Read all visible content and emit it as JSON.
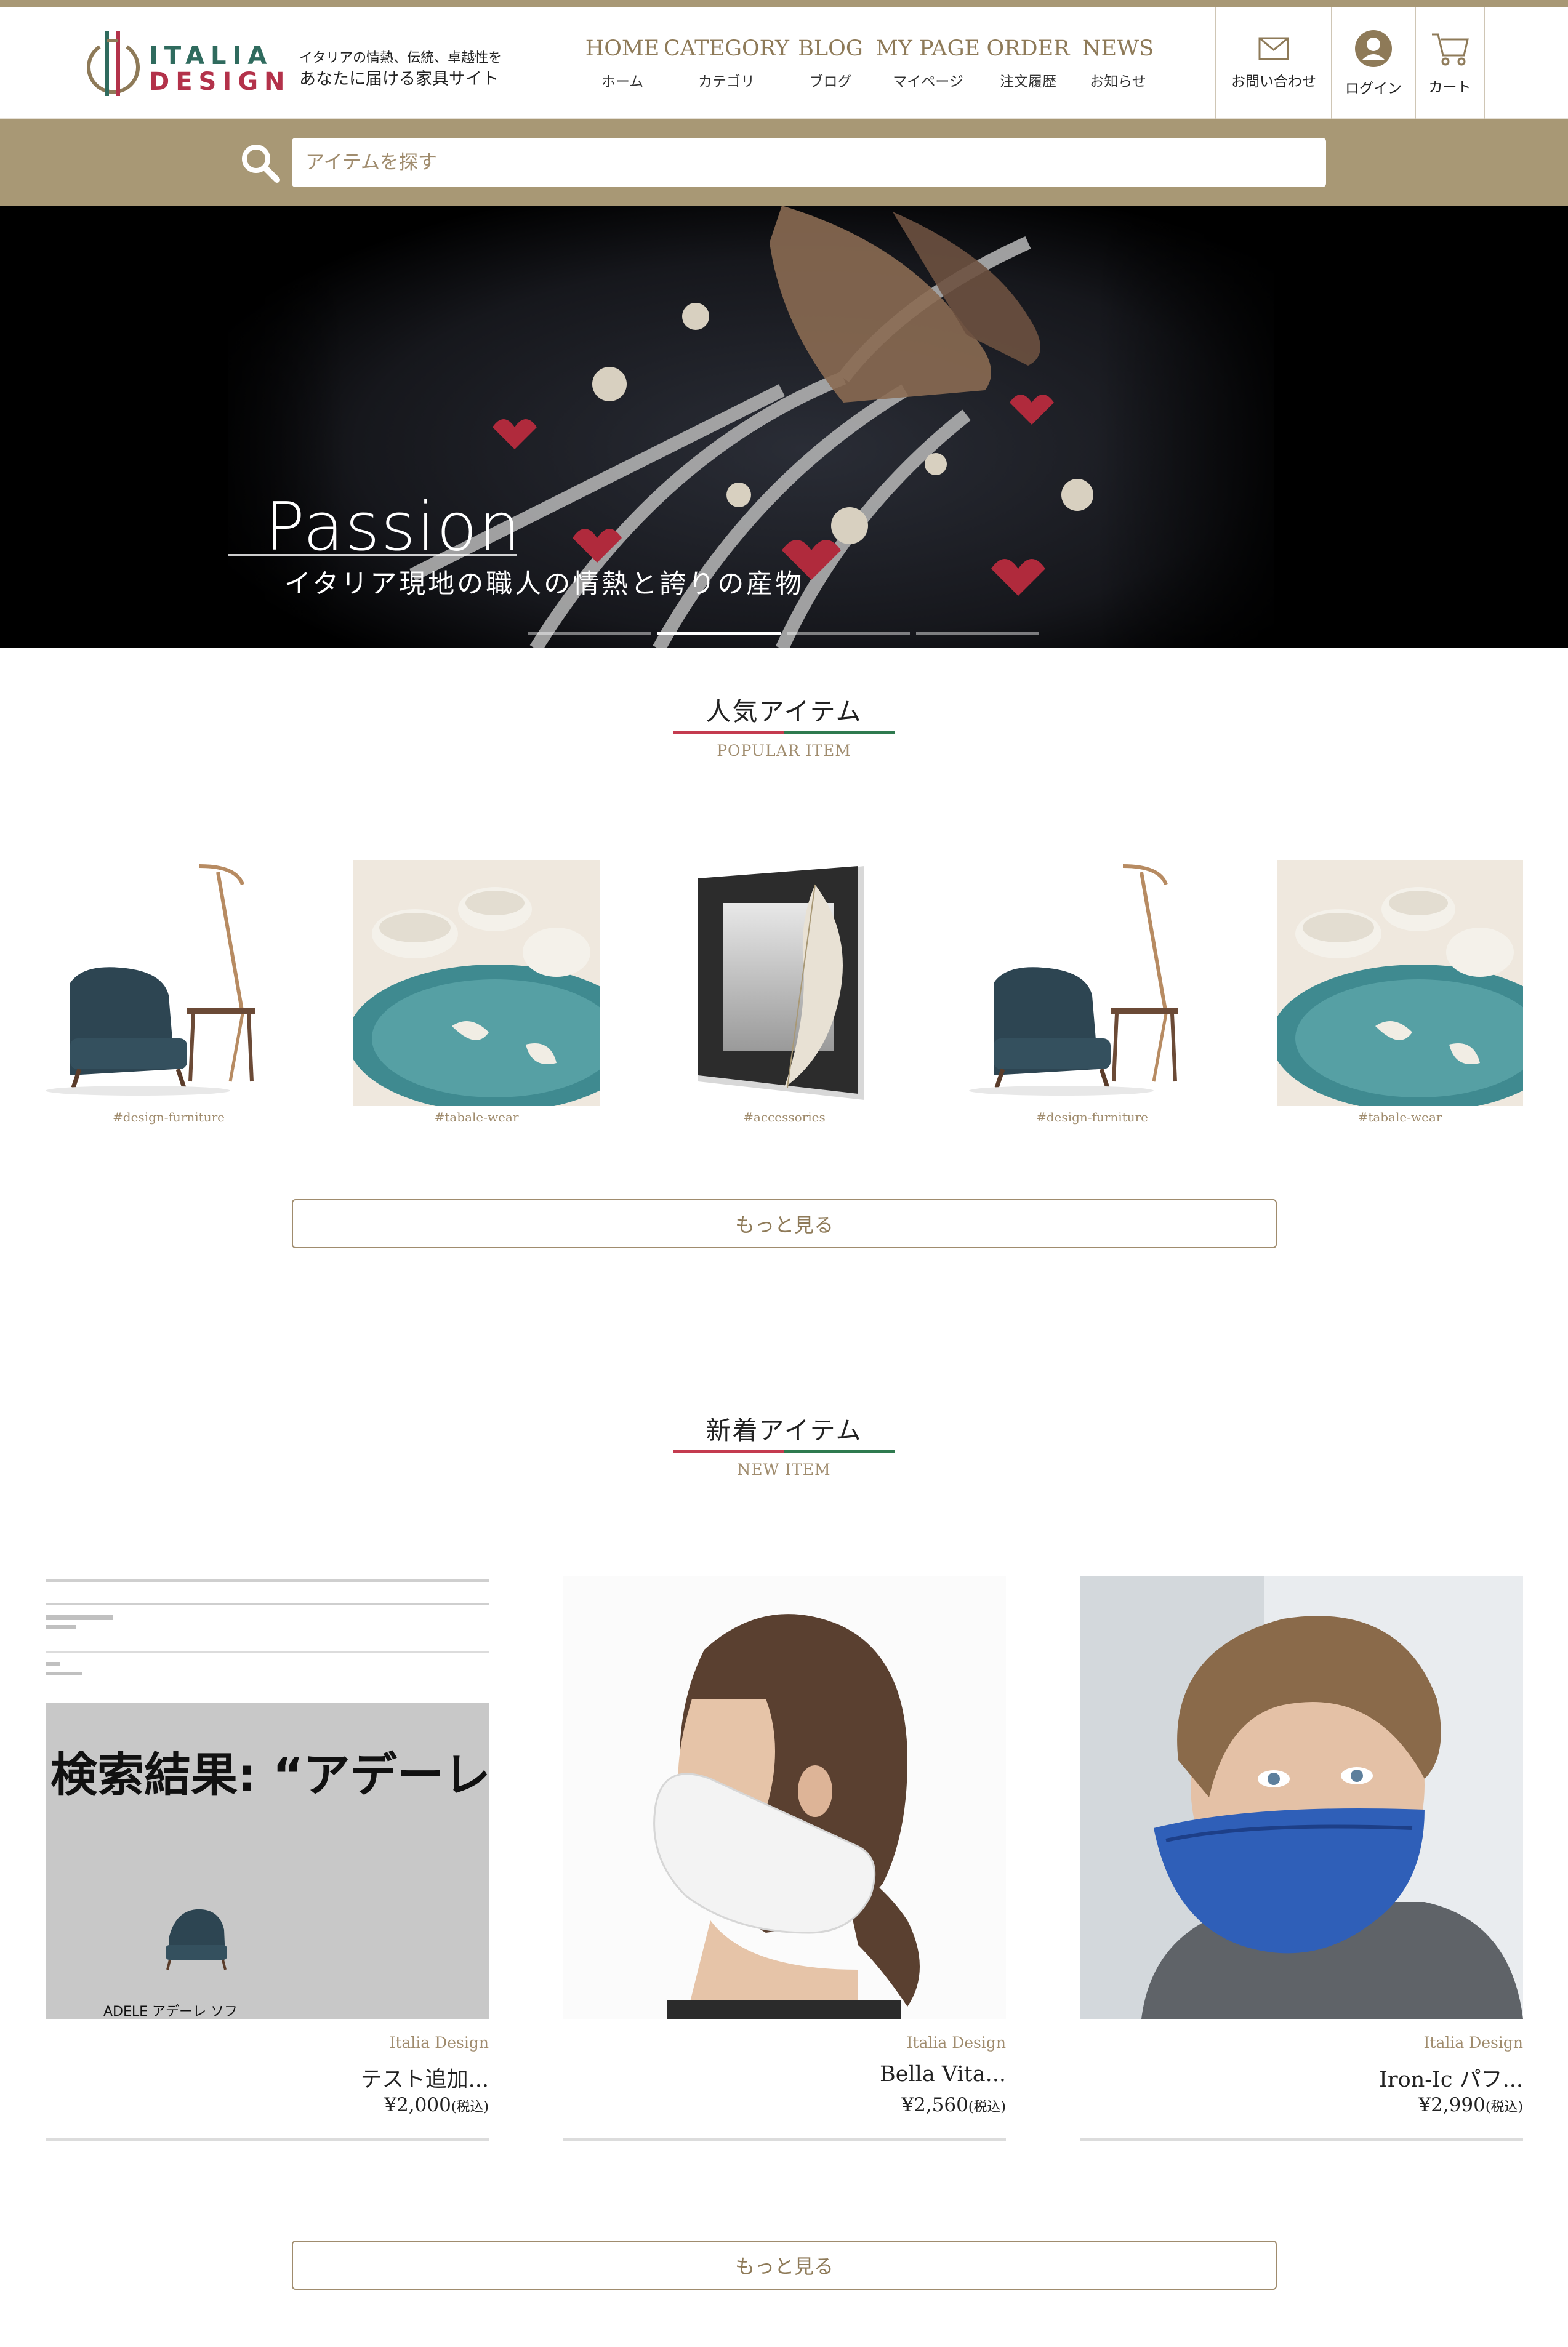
{
  "header": {
    "logo_line1": "ITALIA",
    "logo_line2": "DESIGN",
    "tagline_1": "イタリアの情熱、伝統、卓越性を",
    "tagline_2": "あなたに届ける家具サイト",
    "nav": [
      {
        "en": "HOME",
        "jp": "ホーム"
      },
      {
        "en": "CATEGORY",
        "jp": "カテゴリ"
      },
      {
        "en": "BLOG",
        "jp": "ブログ"
      },
      {
        "en": "MY PAGE",
        "jp": "マイページ"
      },
      {
        "en": "ORDER",
        "jp": "注文履歴"
      },
      {
        "en": "NEWS",
        "jp": "お知らせ"
      }
    ],
    "contact_label": "お問い合わせ",
    "login_label": "ログイン",
    "cart_label": "カート"
  },
  "search": {
    "placeholder": "アイテムを探す"
  },
  "hero": {
    "title": "Passion",
    "subtitle": "イタリア現地の職人の情熱と誇りの産物",
    "slide_count": 4,
    "active_slide": 2
  },
  "popular": {
    "title": "人気アイテム",
    "subtitle": "POPULAR ITEM",
    "items": [
      {
        "tag": "#design-furniture",
        "icon": "armchair-lamp"
      },
      {
        "tag": "#tabale-wear",
        "icon": "ceramic-plate"
      },
      {
        "tag": "#accessories",
        "icon": "feather-frame"
      },
      {
        "tag": "#design-furniture",
        "icon": "armchair-lamp"
      },
      {
        "tag": "#tabale-wear",
        "icon": "ceramic-plate"
      }
    ],
    "more_label": "もっと見る"
  },
  "new_items": {
    "title": "新着アイテム",
    "subtitle": "NEW ITEM",
    "screenshot_heading": "検索結果: “アデーレ”",
    "screenshot_caption": "ADELE アデーレ ソフ",
    "items": [
      {
        "brand": "Italia Design",
        "name": "テスト追加...",
        "price": "¥2,000",
        "tax": "(税込)"
      },
      {
        "brand": "Italia Design",
        "name": "Bella Vita...",
        "price": "¥2,560",
        "tax": "(税込)"
      },
      {
        "brand": "Italia Design",
        "name": "Iron-Ic パフ...",
        "price": "¥2,990",
        "tax": "(税込)"
      }
    ],
    "more_label": "もっと見る"
  },
  "colors": {
    "gold": "#a89875",
    "gold_text": "#8e7a58",
    "italy_red": "#c43b4f",
    "italy_green": "#2f7a4f"
  }
}
